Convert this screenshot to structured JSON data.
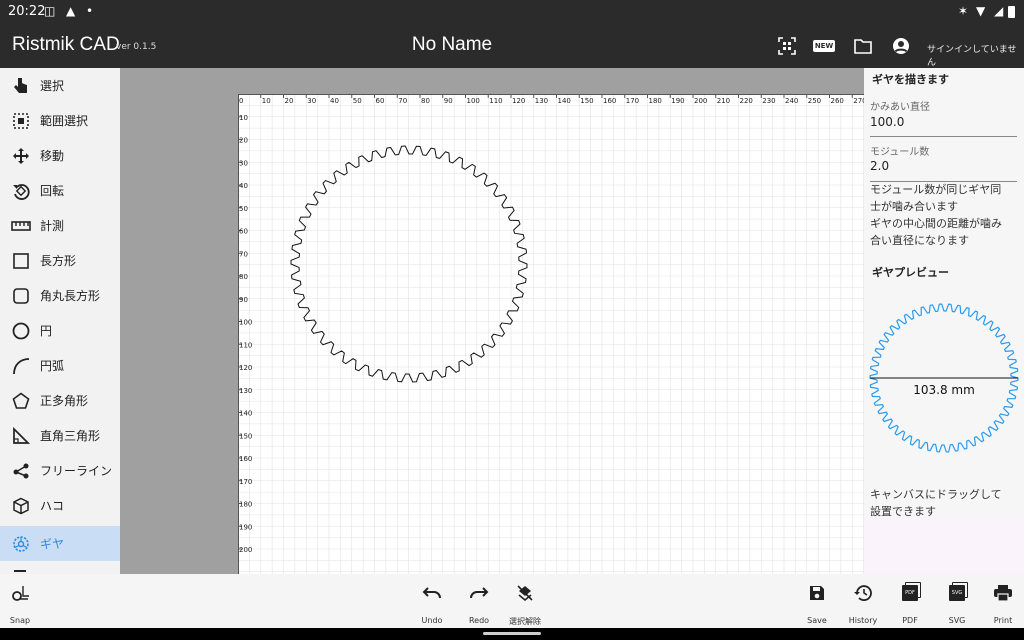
{
  "status_bar": {
    "time": "20:22"
  },
  "app_bar": {
    "app_title": "Ristmik CAD",
    "version": "ver 0.1.5",
    "document_title": "No Name",
    "new_badge": "NEW",
    "signin_text": "サインインしていません"
  },
  "sidebar": {
    "items": [
      {
        "label": "選択",
        "icon": "pointer-hand-icon"
      },
      {
        "label": "範囲選択",
        "icon": "range-select-icon"
      },
      {
        "label": "移動",
        "icon": "move-icon"
      },
      {
        "label": "回転",
        "icon": "rotate-icon"
      },
      {
        "label": "計測",
        "icon": "ruler-icon"
      },
      {
        "label": "長方形",
        "icon": "rectangle-icon"
      },
      {
        "label": "角丸長方形",
        "icon": "rounded-rectangle-icon"
      },
      {
        "label": "円",
        "icon": "circle-icon"
      },
      {
        "label": "円弧",
        "icon": "arc-icon"
      },
      {
        "label": "正多角形",
        "icon": "polygon-icon"
      },
      {
        "label": "直角三角形",
        "icon": "right-triangle-icon"
      },
      {
        "label": "フリーライン",
        "icon": "freeline-icon"
      },
      {
        "label": "ハコ",
        "icon": "box-icon"
      },
      {
        "label": "ギヤ",
        "icon": "gear-icon"
      }
    ],
    "active_item": "ギヤ"
  },
  "canvas": {
    "ruler_x": [
      "0",
      "10",
      "20",
      "30",
      "40",
      "50",
      "60",
      "70",
      "80",
      "90",
      "100",
      "110",
      "120",
      "130",
      "140",
      "150",
      "160",
      "170",
      "180",
      "190",
      "200",
      "210",
      "220",
      "230",
      "240",
      "250",
      "260",
      "270"
    ],
    "ruler_y": [
      "10",
      "20",
      "30",
      "40",
      "50",
      "60",
      "70",
      "80",
      "90",
      "100",
      "110",
      "120",
      "130",
      "140",
      "150",
      "160",
      "170",
      "180",
      "190",
      "200"
    ],
    "gear_teeth": 50
  },
  "right_panel": {
    "title": "ギヤを描きます",
    "pitch_diameter_label": "かみあい直径",
    "pitch_diameter_value": "100.0",
    "module_label": "モジュール数",
    "module_value": "2.0",
    "note1_line1": "モジュール数が同じギヤ同",
    "note1_line2": "士が噛み合います",
    "note1_line3": "ギヤの中心間の距離が噛み",
    "note1_line4": "合い直径になります",
    "preview_title": "ギヤプレビュー",
    "preview_dimension": "103.8 mm",
    "note2_line1": "キャンバスにドラッグして",
    "note2_line2": "設置できます",
    "preview_color": "#2b9bf0"
  },
  "bottom_bar": {
    "snap": "Snap",
    "undo": "Undo",
    "redo": "Redo",
    "deselect": "選択解除",
    "save": "Save",
    "history": "History",
    "pdf": "PDF",
    "pdf_icon_text": "PDF",
    "svg": "SVG",
    "svg_icon_text": "SVG",
    "print": "Print"
  }
}
